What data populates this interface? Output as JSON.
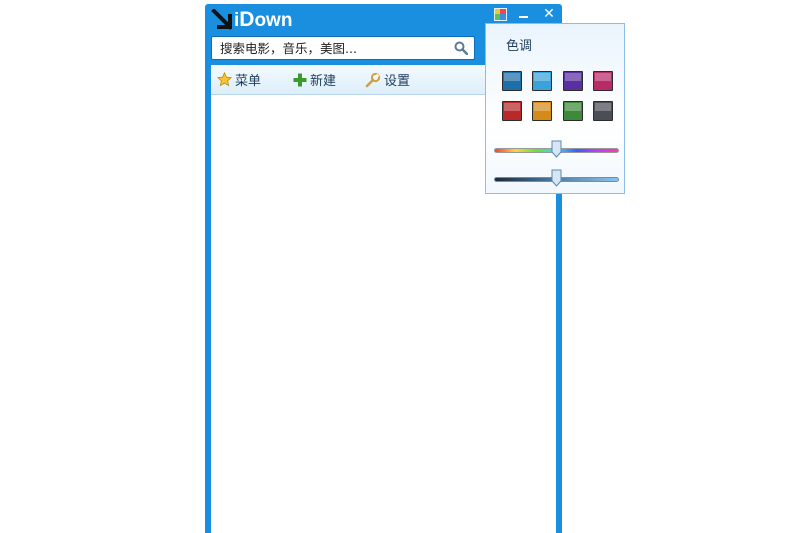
{
  "app": {
    "logo_text_i": "i",
    "logo_text_D": "D",
    "logo_text_rest": "own"
  },
  "window_controls": {
    "skin": "palette-icon",
    "minimize": "minimize-icon",
    "close_label": "✕"
  },
  "search": {
    "placeholder": "搜索电影，音乐，美图..."
  },
  "toolbar": {
    "menu_label": "菜单",
    "new_label": "新建",
    "settings_label": "设置"
  },
  "color_popup": {
    "title": "色调",
    "swatches": [
      "#1e6ea8",
      "#3aa2d8",
      "#5a2fa0",
      "#b82a68",
      "#b82a2a",
      "#d58a1a",
      "#3e8a3a",
      "#4a4e56"
    ],
    "hue_slider_value": 0.5,
    "luminance_slider_value": 0.5
  },
  "colors": {
    "window_blue": "#1a8fe0",
    "toolbar_text": "#1f3d5c"
  }
}
